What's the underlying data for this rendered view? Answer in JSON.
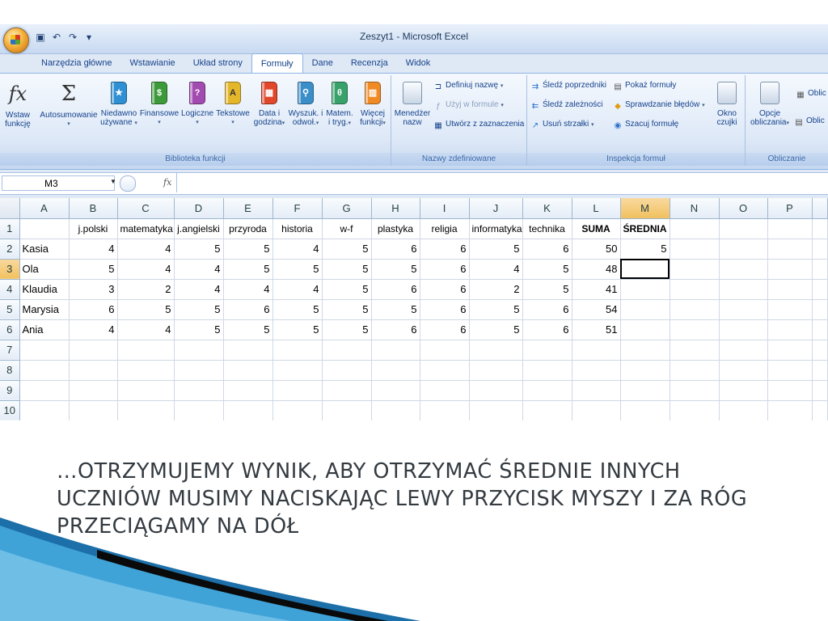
{
  "window": {
    "title": "Zeszyt1 - Microsoft Excel"
  },
  "tabs": [
    "Narzędzia główne",
    "Wstawianie",
    "Układ strony",
    "Formuły",
    "Dane",
    "Recenzja",
    "Widok"
  ],
  "active_tab": "Formuły",
  "ribbon": {
    "biblioteka": {
      "label": "Biblioteka funkcji",
      "wstaw": [
        "Wstaw",
        "funkcję"
      ],
      "autosum": [
        "Autosumowanie",
        ""
      ],
      "niedawno": [
        "Niedawno",
        "używane"
      ],
      "finansowe": [
        "Finansowe",
        ""
      ],
      "logiczne": [
        "Logiczne",
        ""
      ],
      "tekstowe": [
        "Tekstowe",
        ""
      ],
      "dataigodzina": [
        "Data i",
        "godzina"
      ],
      "wyszuk": [
        "Wyszuk. i",
        "odwoł."
      ],
      "matem": [
        "Matem.",
        "i tryg."
      ],
      "wiecej": [
        "Więcej",
        "funkcji"
      ]
    },
    "nazwy": {
      "label": "Nazwy zdefiniowane",
      "menedzer": [
        "Menedżer",
        "nazw"
      ],
      "definiuj": "Definiuj nazwę",
      "uzyj": "Użyj w formule",
      "utworz": "Utwórz z zaznaczenia"
    },
    "inspekcja": {
      "label": "Inspekcja formuł",
      "poprzednikow": "Śledź poprzedniki",
      "zaleznosci": "Śledź zależności",
      "usun": "Usuń strzałki",
      "pokaz": "Pokaż formuły",
      "sprawdzanie": "Sprawdzanie błędów",
      "szacuj": "Szacuj formułę",
      "okno": [
        "Okno",
        "czujki"
      ]
    },
    "obliczanie": {
      "label": "Obliczanie",
      "opcje": [
        "Opcje",
        "obliczania"
      ],
      "oblic1": "Oblic",
      "oblic2": "Oblic"
    }
  },
  "formula_bar": {
    "name_box": "M3",
    "fx": "fx",
    "content": ""
  },
  "columns": [
    "A",
    "B",
    "C",
    "D",
    "E",
    "F",
    "G",
    "H",
    "I",
    "J",
    "K",
    "L",
    "M",
    "N",
    "O",
    "P"
  ],
  "rows": [
    {
      "n": "1",
      "cells": [
        "",
        "j.polski",
        "matematyka",
        "j.angielski",
        "przyroda",
        "historia",
        "w-f",
        "plastyka",
        "religia",
        "informatyka",
        "technika",
        "SUMA",
        "ŚREDNIA",
        "",
        "",
        ""
      ]
    },
    {
      "n": "2",
      "cells": [
        "Kasia",
        "4",
        "4",
        "5",
        "5",
        "4",
        "5",
        "6",
        "6",
        "5",
        "6",
        "50",
        "5",
        "",
        "",
        ""
      ]
    },
    {
      "n": "3",
      "cells": [
        "Ola",
        "5",
        "4",
        "4",
        "5",
        "5",
        "5",
        "5",
        "6",
        "4",
        "5",
        "48",
        "",
        "",
        "",
        ""
      ]
    },
    {
      "n": "4",
      "cells": [
        "Klaudia",
        "3",
        "2",
        "4",
        "4",
        "4",
        "5",
        "6",
        "6",
        "2",
        "5",
        "41",
        "",
        "",
        "",
        ""
      ]
    },
    {
      "n": "5",
      "cells": [
        "Marysia",
        "6",
        "5",
        "5",
        "6",
        "5",
        "5",
        "5",
        "6",
        "5",
        "6",
        "54",
        "",
        "",
        "",
        ""
      ]
    },
    {
      "n": "6",
      "cells": [
        "Ania",
        "4",
        "4",
        "5",
        "5",
        "5",
        "5",
        "6",
        "6",
        "5",
        "6",
        "51",
        "",
        "",
        "",
        ""
      ]
    },
    {
      "n": "7",
      "cells": [
        "",
        "",
        "",
        "",
        "",
        "",
        "",
        "",
        "",
        "",
        "",
        "",
        "",
        "",
        "",
        ""
      ]
    },
    {
      "n": "8",
      "cells": [
        "",
        "",
        "",
        "",
        "",
        "",
        "",
        "",
        "",
        "",
        "",
        "",
        "",
        "",
        "",
        ""
      ]
    },
    {
      "n": "9",
      "cells": [
        "",
        "",
        "",
        "",
        "",
        "",
        "",
        "",
        "",
        "",
        "",
        "",
        "",
        "",
        "",
        ""
      ]
    },
    {
      "n": "10",
      "cells": [
        "",
        "",
        "",
        "",
        "",
        "",
        "",
        "",
        "",
        "",
        "",
        "",
        "",
        "",
        "",
        ""
      ]
    }
  ],
  "selected_cell": {
    "col": "M",
    "row": "3"
  },
  "caption": "…OTRZYMUJEMY WYNIK, ABY OTRZYMAĆ ŚREDNIE INNYCH UCZNIÓW MUSIMY NACISKAJĄC LEWY PRZYCISK MYSZY I ZA RÓG PRZECIĄGAMY NA DÓŁ",
  "colors": {
    "ribbon_blue": "#dde8f7",
    "tab_text": "#15428b",
    "active_header": "#f1c15f",
    "caption_text": "#333a40",
    "swoosh_blue": "#2a8bc4"
  }
}
